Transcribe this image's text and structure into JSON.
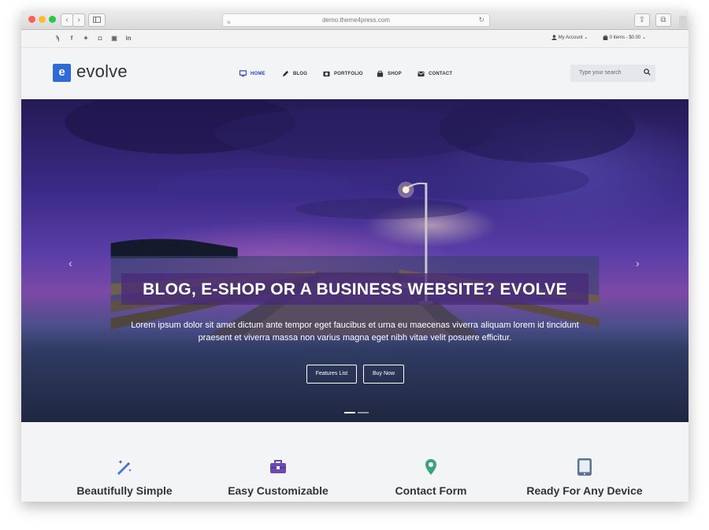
{
  "browser": {
    "url": "demo.theme4press.com",
    "back_icon": "chevron-left-icon",
    "forward_icon": "chevron-right-icon"
  },
  "topbar": {
    "social": [
      "rss-icon",
      "facebook-icon",
      "twitter-icon",
      "instagram-icon",
      "youtube-icon",
      "linkedin-icon"
    ],
    "my_account": "My Account",
    "cart": "0 items - $0.00"
  },
  "header": {
    "logo_letter": "e",
    "logo_text": "evolve",
    "nav": [
      {
        "label": "HOME",
        "active": true
      },
      {
        "label": "BLOG"
      },
      {
        "label": "PORTFOLIO"
      },
      {
        "label": "SHOP"
      },
      {
        "label": "CONTACT"
      }
    ],
    "search_placeholder": "Type your search"
  },
  "hero": {
    "headline": "BLOG, E-SHOP OR A BUSINESS WEBSITE? EVOLVE",
    "subtext_line1": "Lorem ipsum dolor sit amet dictum ante tempor eget faucibus et urna eu maecenas viverra aliquam lorem id tincidunt",
    "subtext_line2": "praesent et viverra massa non varius magna eget nibh vitae velit posuere efficitur.",
    "buttons": [
      "Features List",
      "Buy Now"
    ],
    "slide_count": 2,
    "active_slide": 1
  },
  "features": [
    {
      "title": "Beautifully Simple",
      "icon": "magic-wand-icon"
    },
    {
      "title": "Easy Customizable",
      "icon": "toolbox-icon"
    },
    {
      "title": "Contact Form",
      "icon": "map-pin-icon"
    },
    {
      "title": "Ready For Any Device",
      "icon": "tablet-icon"
    }
  ],
  "colors": {
    "accent": "#2e6bd6",
    "nav_active": "#2e3fc9",
    "feature_icon_blue": "#3e7bd6",
    "feature_icon_purple": "#6b4bb3",
    "feature_icon_green": "#3aa57a",
    "feature_icon_slate": "#5a7390"
  }
}
